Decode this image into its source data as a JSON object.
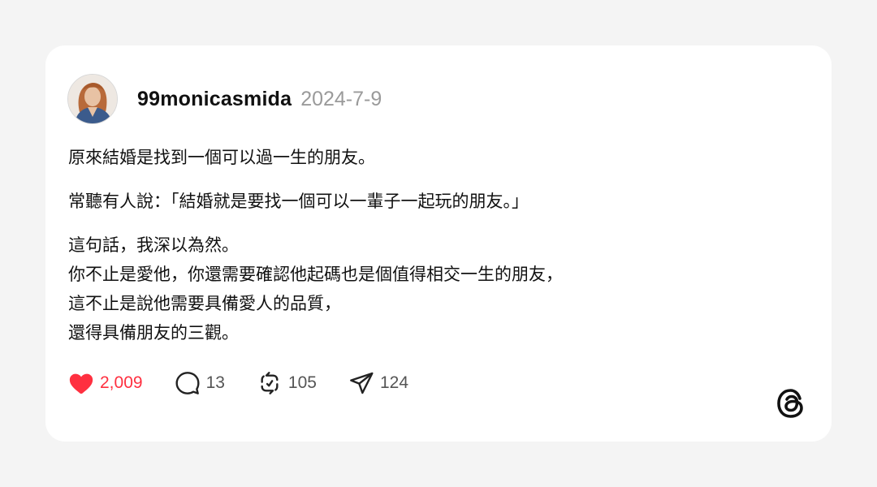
{
  "post": {
    "username": "99monicasmida",
    "date": "2024-7-9",
    "paragraphs": [
      [
        "原來結婚是找到一個可以過一生的朋友。"
      ],
      [
        "常聽有人說：「結婚就是要找一個可以一輩子一起玩的朋友。」"
      ],
      [
        "這句話，我深以為然。",
        "你不止是愛他，你還需要確認他起碼也是個值得相交一生的朋友，",
        "這不止是說他需要具備愛人的品質，",
        "還得具備朋友的三觀。"
      ]
    ]
  },
  "actions": {
    "likes": "2,009",
    "comments": "13",
    "reposts": "105",
    "shares": "124"
  },
  "icons": {
    "like": "heart-icon",
    "comment": "comment-bubble-icon",
    "repost": "repost-icon",
    "share": "send-icon",
    "brand": "threads-logo-icon"
  },
  "colors": {
    "like_active": "#ff3040",
    "background": "#f4f4f4",
    "card": "#ffffff"
  }
}
